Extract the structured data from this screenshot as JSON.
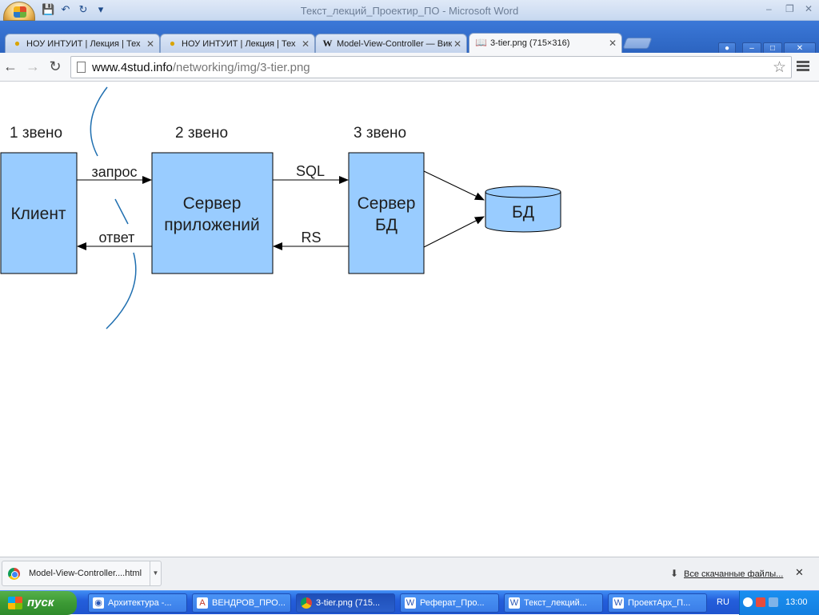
{
  "word": {
    "title": "Текст_лекций_Проектир_ПО - Microsoft Word",
    "quick_access": [
      "save-icon",
      "undo-icon",
      "redo-icon",
      "customize-icon"
    ]
  },
  "browser": {
    "tabs": [
      {
        "label": "НОУ ИНТУИТ | Лекция | Тех",
        "icon": "intuit-icon",
        "active": false
      },
      {
        "label": "НОУ ИНТУИТ | Лекция | Тех",
        "icon": "intuit-icon",
        "active": false
      },
      {
        "label": "Model-View-Controller — Вик",
        "icon": "wikipedia-icon",
        "active": false
      },
      {
        "label": "3-tier.png (715×316)",
        "icon": "image-file-icon",
        "active": true
      }
    ],
    "url_host": "www.4stud.info",
    "url_path": "/networking/img/3-tier.png"
  },
  "diagram": {
    "tier_labels": [
      "1 звено",
      "2 звено",
      "3 звено"
    ],
    "client": "Клиент",
    "app_server": [
      "Сервер",
      "приложений"
    ],
    "db_server": [
      "Сервер",
      "БД"
    ],
    "database": "БД",
    "request": "запрос",
    "response": "ответ",
    "sql": "SQL",
    "rs": "RS",
    "colors": {
      "box_fill": "#99ccff",
      "stroke": "#000000",
      "curve": "#1f6fb0"
    }
  },
  "downloads": {
    "item": "Model-View-Controller....html",
    "show_all": "Все скачанные файлы..."
  },
  "taskbar": {
    "start_label": "пуск",
    "tasks": [
      {
        "label": "Архитектура -...",
        "icon": "browser-icon"
      },
      {
        "label": "ВЕНДРОВ_ПРО...",
        "icon": "pdf-icon"
      },
      {
        "label": "3-tier.png (715...",
        "icon": "chrome-icon"
      },
      {
        "label": "Реферат_Про...",
        "icon": "word-icon"
      },
      {
        "label": "Текст_лекций...",
        "icon": "word-icon"
      },
      {
        "label": "ПроектАрх_П...",
        "icon": "word-icon"
      }
    ],
    "language": "RU",
    "clock": "13:00"
  }
}
